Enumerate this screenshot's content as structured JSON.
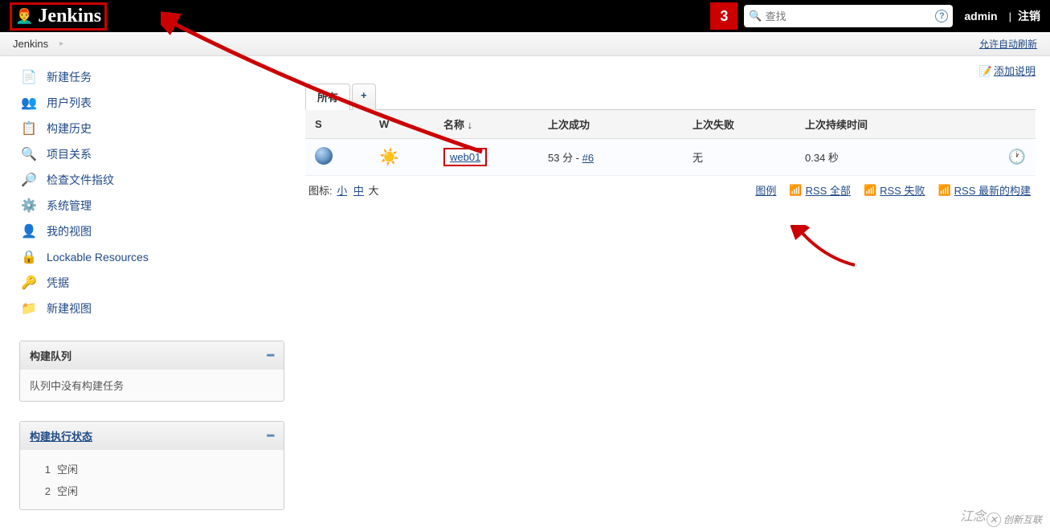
{
  "header": {
    "logo_text": "Jenkins",
    "badge": "3",
    "search_placeholder": "查找",
    "user": "admin",
    "logout": "注销"
  },
  "breadcrumb": {
    "item": "Jenkins",
    "auto_refresh": "允许自动刷新"
  },
  "sidebar": [
    {
      "icon": "📄",
      "label": "新建任务",
      "name": "new-item"
    },
    {
      "icon": "👥",
      "label": "用户列表",
      "name": "people"
    },
    {
      "icon": "📋",
      "label": "构建历史",
      "name": "build-history"
    },
    {
      "icon": "🔍",
      "label": "项目关系",
      "name": "project-relationship"
    },
    {
      "icon": "🔎",
      "label": "检查文件指纹",
      "name": "check-fingerprint"
    },
    {
      "icon": "⚙️",
      "label": "系统管理",
      "name": "manage-jenkins"
    },
    {
      "icon": "👤",
      "label": "我的视图",
      "name": "my-views"
    },
    {
      "icon": "🔒",
      "label": "Lockable Resources",
      "name": "lockable-resources"
    },
    {
      "icon": "🔑",
      "label": "凭据",
      "name": "credentials"
    },
    {
      "icon": "📁",
      "label": "新建视图",
      "name": "new-view"
    }
  ],
  "build_queue": {
    "title": "构建队列",
    "empty_text": "队列中没有构建任务"
  },
  "executors": {
    "title": "构建执行状态",
    "items": [
      {
        "num": "1",
        "state": "空闲"
      },
      {
        "num": "2",
        "state": "空闲"
      }
    ]
  },
  "main": {
    "add_description": "添加说明",
    "tabs": {
      "all": "所有",
      "plus": "+"
    },
    "columns": {
      "s": "S",
      "w": "W",
      "name": "名称 ↓",
      "last_success": "上次成功",
      "last_failure": "上次失败",
      "last_duration": "上次持续时间"
    },
    "jobs": [
      {
        "name": "web01",
        "last_success_time": "53 分",
        "last_success_build": "#6",
        "last_failure": "无",
        "last_duration": "0.34 秒"
      }
    ],
    "icon_label": "图标:",
    "icon_sizes": {
      "s": "小",
      "m": "中",
      "l": "大"
    },
    "legend": "图例",
    "rss_all": "RSS 全部",
    "rss_failed": "RSS 失败",
    "rss_latest": "RSS 最新的构建"
  },
  "watermarks": {
    "a": "江念",
    "b": "创新互联"
  }
}
